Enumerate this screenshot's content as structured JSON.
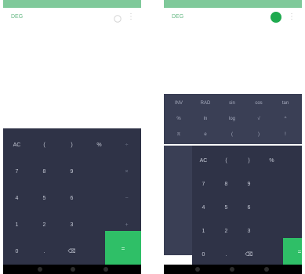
{
  "left": {
    "mode_label": "DEG",
    "keys": [
      [
        {
          "t": "AC",
          "cls": ""
        },
        {
          "t": "(",
          "cls": ""
        },
        {
          "t": ")",
          "cls": ""
        },
        {
          "t": "%",
          "cls": ""
        },
        {
          "t": "÷",
          "cls": "dim"
        }
      ],
      [
        {
          "t": "7",
          "cls": ""
        },
        {
          "t": "8",
          "cls": ""
        },
        {
          "t": "9",
          "cls": ""
        },
        {
          "t": "",
          "cls": ""
        },
        {
          "t": "×",
          "cls": "dim"
        }
      ],
      [
        {
          "t": "4",
          "cls": ""
        },
        {
          "t": "5",
          "cls": ""
        },
        {
          "t": "6",
          "cls": ""
        },
        {
          "t": "",
          "cls": ""
        },
        {
          "t": "−",
          "cls": "dim"
        }
      ],
      [
        {
          "t": "1",
          "cls": ""
        },
        {
          "t": "2",
          "cls": ""
        },
        {
          "t": "3",
          "cls": ""
        },
        {
          "t": "",
          "cls": ""
        },
        {
          "t": "+",
          "cls": "dim"
        }
      ],
      [
        {
          "t": "0",
          "cls": ""
        },
        {
          "t": ".",
          "cls": ""
        },
        {
          "t": "⌫",
          "cls": ""
        },
        {
          "t": "",
          "cls": ""
        },
        {
          "t": "",
          "cls": ""
        }
      ]
    ],
    "equals": "="
  },
  "right": {
    "mode_label": "DEG",
    "sci_rows": [
      [
        "INV",
        "RAD",
        "sin",
        "cos",
        "tan"
      ],
      [
        "%",
        "ln",
        "log",
        "√",
        "^"
      ],
      [
        "π",
        "e",
        "(",
        ")",
        "!"
      ]
    ],
    "keys": [
      [
        {
          "t": "AC",
          "cls": ""
        },
        {
          "t": "(",
          "cls": ""
        },
        {
          "t": ")",
          "cls": ""
        },
        {
          "t": "%",
          "cls": ""
        }
      ],
      [
        {
          "t": "7",
          "cls": ""
        },
        {
          "t": "8",
          "cls": ""
        },
        {
          "t": "9",
          "cls": ""
        },
        {
          "t": "",
          "cls": ""
        }
      ],
      [
        {
          "t": "4",
          "cls": ""
        },
        {
          "t": "5",
          "cls": ""
        },
        {
          "t": "6",
          "cls": ""
        },
        {
          "t": "",
          "cls": ""
        }
      ],
      [
        {
          "t": "1",
          "cls": ""
        },
        {
          "t": "2",
          "cls": ""
        },
        {
          "t": "3",
          "cls": ""
        },
        {
          "t": "",
          "cls": ""
        }
      ],
      [
        {
          "t": "0",
          "cls": ""
        },
        {
          "t": ".",
          "cls": ""
        },
        {
          "t": "⌫",
          "cls": ""
        },
        {
          "t": "",
          "cls": ""
        }
      ]
    ],
    "equals": "="
  },
  "icons": {
    "history": "history-icon",
    "menu": "menu-icon",
    "back": "back-icon",
    "home": "home-icon",
    "recents": "recents-icon"
  }
}
